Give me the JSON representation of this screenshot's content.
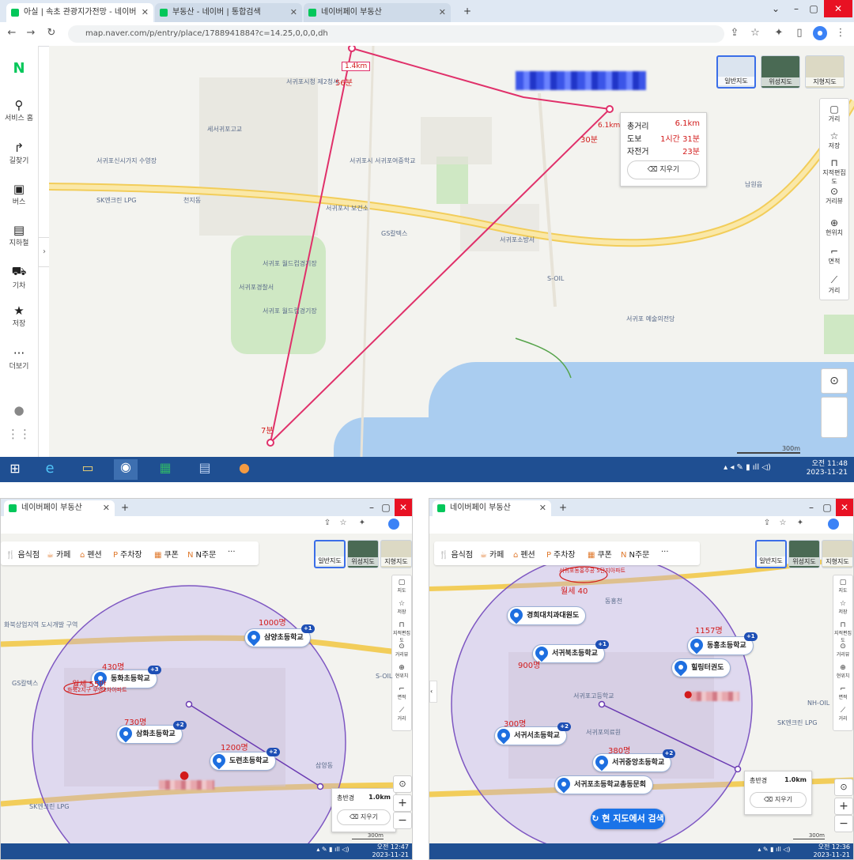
{
  "top": {
    "tabs": [
      {
        "label": "아실 | 속초 관광지가전망 - 네이버"
      },
      {
        "label": "부동산 - 네이버 | 통합검색"
      },
      {
        "label": "네이버페이 부동산"
      }
    ],
    "url": "map.naver.com/p/entry/place/1788941884?c=14.25,0,0,0,dh",
    "sidebar": [
      {
        "label": "서비스 홈",
        "icon": "pin-icon",
        "glyph": "⚲"
      },
      {
        "label": "길찾기",
        "icon": "directions-icon",
        "glyph": "↱"
      },
      {
        "label": "버스",
        "icon": "bus-icon",
        "glyph": "▣"
      },
      {
        "label": "지하철",
        "icon": "subway-icon",
        "glyph": "▤"
      },
      {
        "label": "기차",
        "icon": "train-icon",
        "glyph": "⛟"
      },
      {
        "label": "저장",
        "icon": "star-icon",
        "glyph": "★"
      },
      {
        "label": "더보기",
        "icon": "more-icon",
        "glyph": "···"
      }
    ],
    "maptypes": [
      "일반지도",
      "위성지도",
      "지형지도"
    ],
    "tools": [
      {
        "label": "거리",
        "glyph": "▢"
      },
      {
        "label": "저장",
        "glyph": "☆"
      },
      {
        "label": "지적편집도",
        "glyph": "⊓"
      },
      {
        "label": "거리뷰",
        "glyph": "⊙"
      },
      {
        "label": "현위치",
        "glyph": "⊕"
      },
      {
        "label": "면적",
        "glyph": "⌐"
      },
      {
        "label": "거리",
        "glyph": "⟋"
      }
    ],
    "distance_panel": {
      "total_label": "총거리",
      "total_value": "6.1km",
      "walk_label": "도보",
      "walk_value": "1시간 31분",
      "bike_label": "자전거",
      "bike_value": "23분",
      "clear_button": "지우기"
    },
    "segment_labels": {
      "seg1": "1.4km",
      "seg1_time": "56분",
      "seg2": "6.1km",
      "seg2_time": "30분",
      "seg3": "7분"
    },
    "pois": [
      "서귀포시청 제2청사",
      "세서귀포고교",
      "서귀포신시가지 수영장",
      "SK엔크린 LPG",
      "천지동",
      "서귀포 월드컵경기장",
      "서귀포시 서귀포여중학교",
      "서귀포시 보건소",
      "GS칼텍스",
      "S-OIL",
      "서귀포 예술의전당",
      "서귀포소방서",
      "서귀포경찰서",
      "남원읍",
      "서귀포 월드컵경기장"
    ],
    "scale": "300m",
    "taskbar_time": "오전 11:48",
    "taskbar_date": "2023-11-21"
  },
  "left": {
    "tab": "네이버페이 부동산",
    "chips": [
      {
        "label": "음식점",
        "glyph": "🍴"
      },
      {
        "label": "카페",
        "glyph": "☕"
      },
      {
        "label": "펜션",
        "glyph": "⌂"
      },
      {
        "label": "주차장",
        "glyph": "P"
      },
      {
        "label": "쿠폰",
        "glyph": "▦"
      },
      {
        "label": "N주문",
        "glyph": "N"
      },
      {
        "label": "···",
        "glyph": ""
      }
    ],
    "maptypes": [
      "일반지도",
      "위성지도",
      "지형지도"
    ],
    "tools": [
      "지도",
      "저장",
      "지적편집도",
      "거리뷰",
      "현위치",
      "면적",
      "거리"
    ],
    "schools": [
      {
        "name": "삼양초등학교",
        "count": "1000명",
        "plus": "+1"
      },
      {
        "name": "동화초등학교",
        "count": "430명",
        "plus": "+3"
      },
      {
        "name": "삼화초등학교",
        "count": "730명",
        "plus": "+2"
      },
      {
        "name": "도련초등학교",
        "count": "1200명",
        "plus": "+2"
      }
    ],
    "annotation": "월세 55만",
    "annotation_circle": "화북2지구 부영2차아파트",
    "area_labels": [
      "화북상업지역 도시개발 구역",
      "삼양동",
      "S-OIL",
      "GS칼텍스",
      "SK엔크린 LPG"
    ],
    "radius_label": "총반경",
    "radius_value": "1.0km",
    "clear_button": "지우기",
    "scale": "300m",
    "time": "오전 12:47",
    "date": "2023-11-21"
  },
  "right": {
    "tab": "네이버페이 부동산",
    "chips": [
      {
        "label": "음식점",
        "glyph": "🍴"
      },
      {
        "label": "카페",
        "glyph": "☕"
      },
      {
        "label": "펜션",
        "glyph": "⌂"
      },
      {
        "label": "주차장",
        "glyph": "P"
      },
      {
        "label": "쿠폰",
        "glyph": "▦"
      },
      {
        "label": "N주문",
        "glyph": "N"
      },
      {
        "label": "···",
        "glyph": ""
      }
    ],
    "maptypes": [
      "일반지도",
      "위성지도",
      "지형지도"
    ],
    "tools": [
      "지도",
      "저장",
      "지적편집도",
      "거리뷰",
      "현위치",
      "면적",
      "거리"
    ],
    "schools": [
      {
        "name": "경희대치과대원도",
        "count": "",
        "plus": ""
      },
      {
        "name": "서귀북초등학교",
        "count": "900명",
        "plus": "+1"
      },
      {
        "name": "동홍초등학교",
        "count": "1157명",
        "plus": "+1"
      },
      {
        "name": "힐링터권도",
        "count": "",
        "plus": ""
      },
      {
        "name": "서귀서초등학교",
        "count": "300명",
        "plus": "+2"
      },
      {
        "name": "서귀중앙초등학교",
        "count": "380명",
        "plus": "+2"
      },
      {
        "name": "서귀포초등학교총동문회",
        "count": "",
        "plus": ""
      }
    ],
    "annotation": "월세 40",
    "annotation_circle": "서귀포동홍주공 5단지아파트",
    "area_labels": [
      "동홍천",
      "NH-OIL",
      "SK엔크린 LPG",
      "서귀포고등학교",
      "서귀포의료원"
    ],
    "radius_label": "총반경",
    "radius_value": "1.0km",
    "clear_button": "지우기",
    "search_button": "현 지도에서 검색",
    "scale": "300m",
    "time": "오전 12:36",
    "date": "2023-11-21"
  }
}
